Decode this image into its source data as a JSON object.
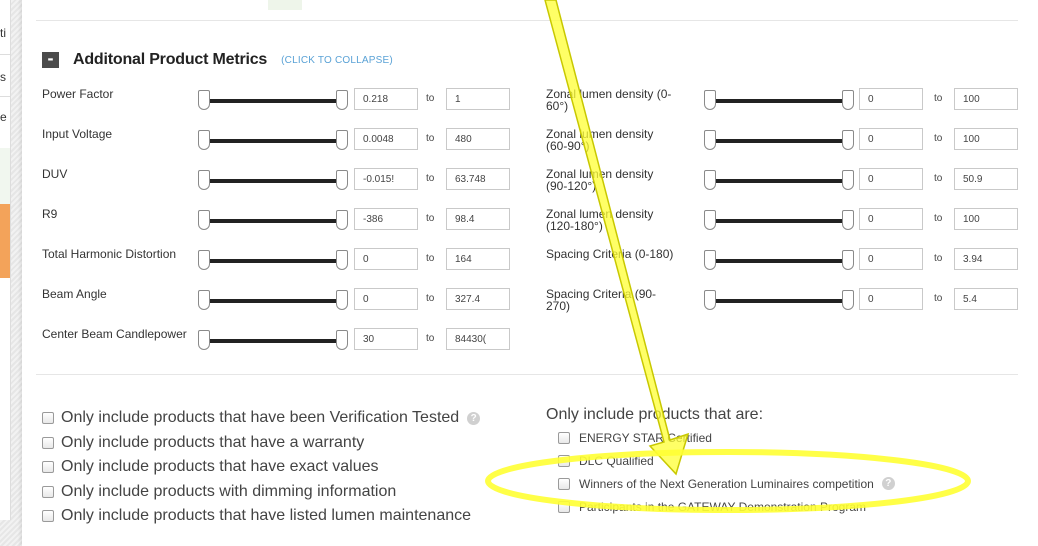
{
  "background_fragments": [
    "ti",
    "s",
    "e"
  ],
  "section": {
    "collapse_button": "-",
    "title": "Additonal Product Metrics",
    "collapse_hint": "(CLICK TO COLLAPSE)"
  },
  "range_separator": "to",
  "metrics_left": [
    {
      "label": "Power Factor",
      "min": "0.218",
      "max": "1"
    },
    {
      "label": "Input Voltage",
      "min": "0.0048",
      "max": "480"
    },
    {
      "label": "DUV",
      "min": "-0.015!",
      "max": "63.748"
    },
    {
      "label": "R9",
      "min": "-386",
      "max": "98.4"
    },
    {
      "label": "Total Harmonic Distortion",
      "min": "0",
      "max": "164"
    },
    {
      "label": "Beam Angle",
      "min": "0",
      "max": "327.4"
    },
    {
      "label": "Center Beam Candlepower",
      "min": "30",
      "max": "84430("
    }
  ],
  "metrics_right": [
    {
      "label": "Zonal lumen density (0-60°)",
      "min": "0",
      "max": "100"
    },
    {
      "label": "Zonal lumen density (60-90°)",
      "min": "0",
      "max": "100"
    },
    {
      "label": "Zonal lumen density (90-120°)",
      "min": "0",
      "max": "50.9"
    },
    {
      "label": "Zonal lumen density (120-180°)",
      "min": "0",
      "max": "100"
    },
    {
      "label": "Spacing Criteria (0-180)",
      "min": "0",
      "max": "3.94"
    },
    {
      "label": "Spacing Criteria (90-270)",
      "min": "0",
      "max": "5.4"
    }
  ],
  "filters_left": [
    {
      "label": "Only include products that have been Verification Tested",
      "info_icon": true
    },
    {
      "label": "Only include products that have a warranty"
    },
    {
      "label": "Only include products that have exact values"
    },
    {
      "label": "Only include products with dimming information"
    },
    {
      "label": "Only include products that have listed lumen maintenance"
    }
  ],
  "filters_right": {
    "lead": "Only include products that are:",
    "items": [
      {
        "label": "ENERGY STAR Certified"
      },
      {
        "label": "DLC Qualified"
      },
      {
        "label": "Winners of the Next Generation Luminaires competition",
        "info_icon": true
      },
      {
        "label": "Participants in the GATEWAY Demonstration Program"
      }
    ]
  },
  "info_icon_glyph": "?",
  "annotation": {
    "color": "#ffff33",
    "stroke": "#c8c800",
    "shapes": [
      "arrow",
      "ellipse"
    ]
  }
}
